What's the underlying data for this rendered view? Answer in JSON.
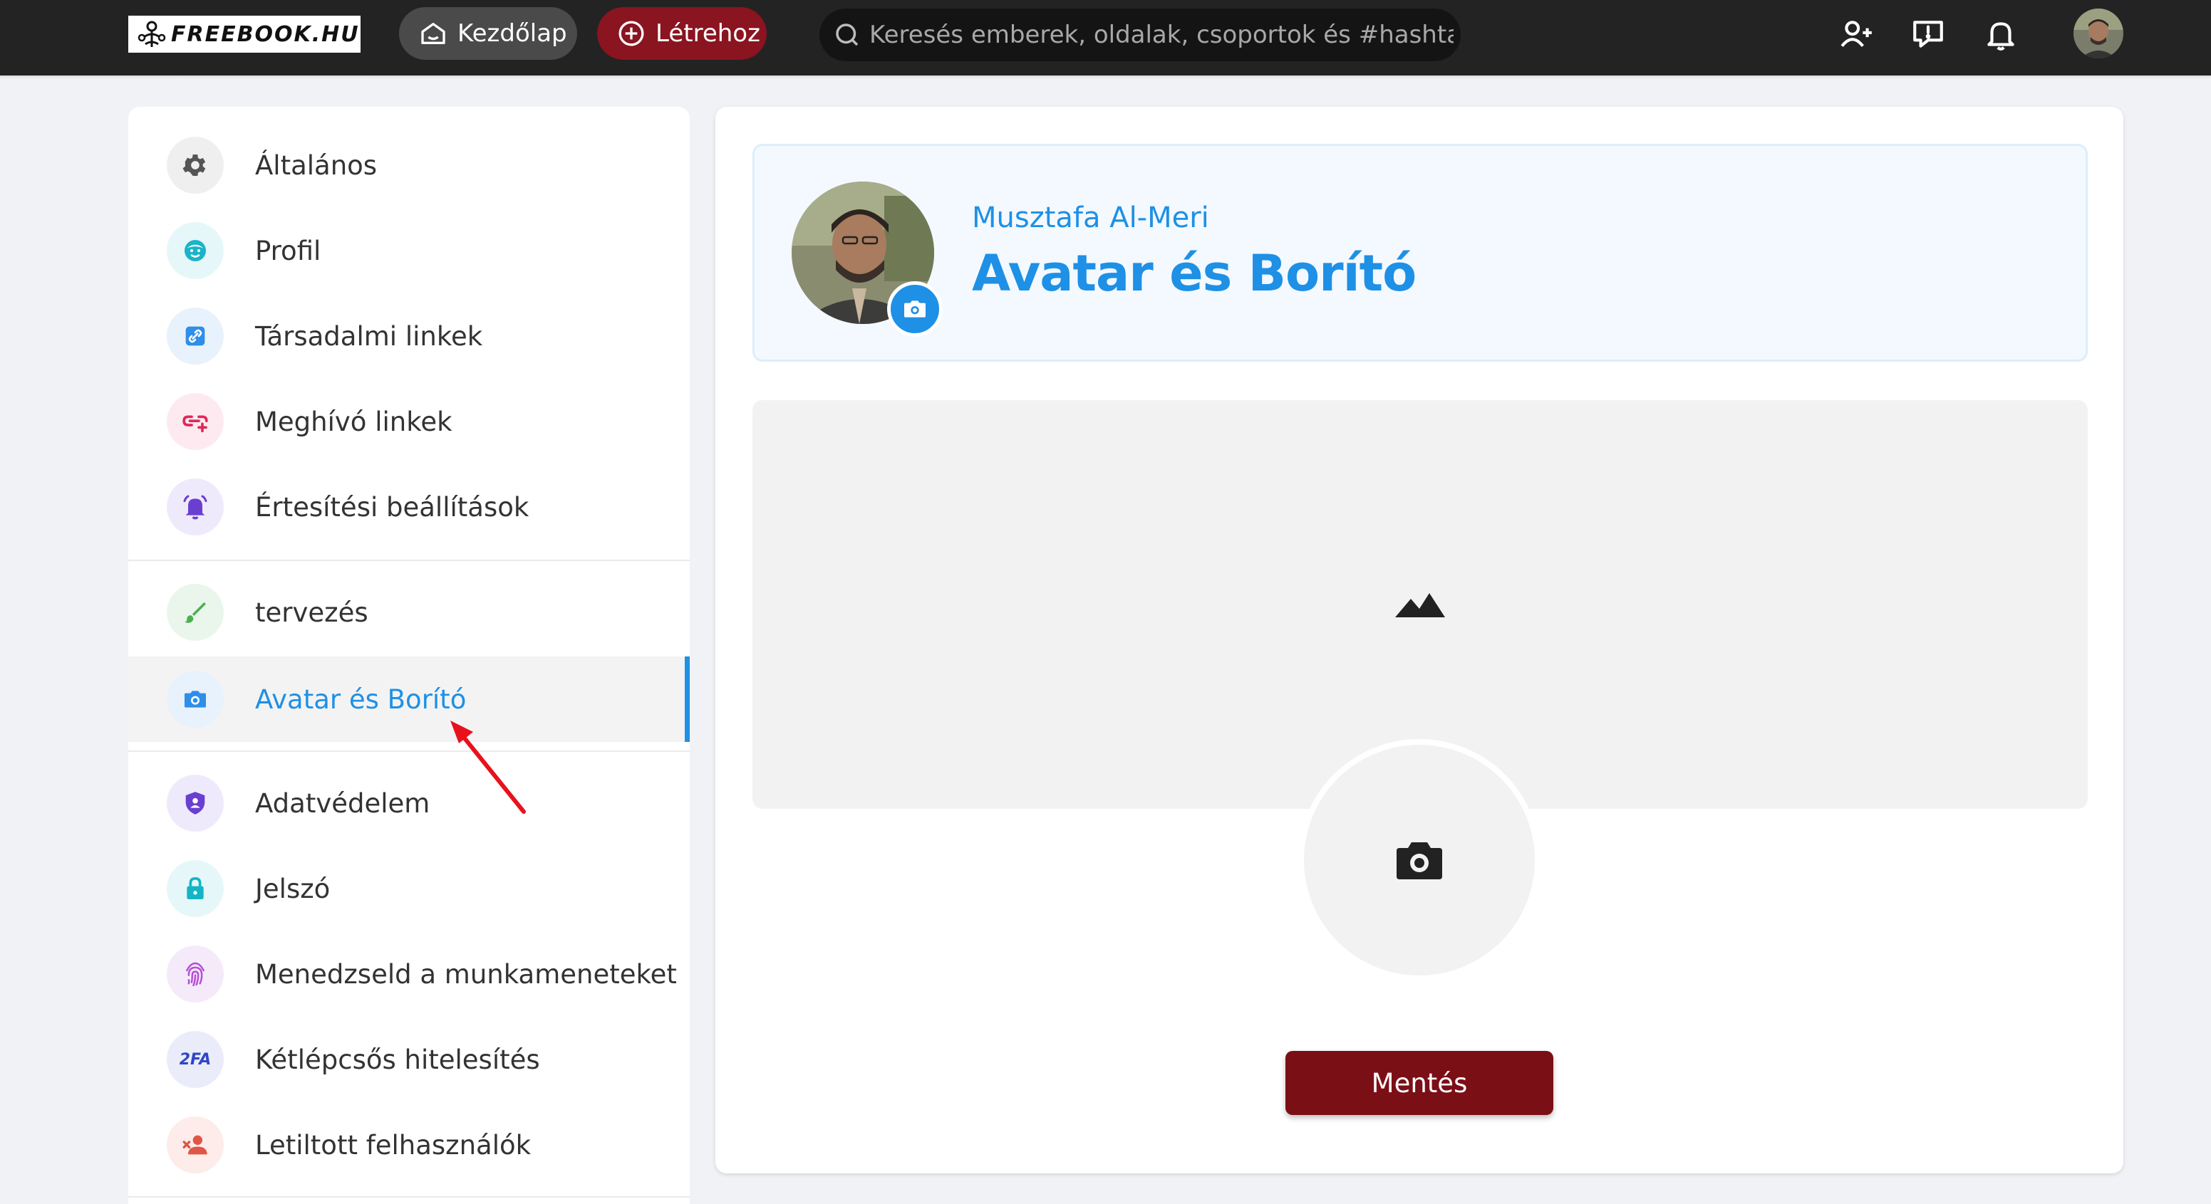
{
  "topbar": {
    "logo_text": "FREEBOOK.HU",
    "home_label": "Kezdőlap",
    "create_label": "Létrehoz",
    "search_placeholder": "Keresés emberek, oldalak, csoportok és #hashtag-ek",
    "icons": [
      "add-friend-icon",
      "messages-icon",
      "notifications-bell-icon",
      "user-avatar"
    ]
  },
  "sidebar": {
    "items": [
      {
        "label": "Általános",
        "icon": "gear-icon",
        "icon_color": "#555555",
        "bg": "#efefef"
      },
      {
        "label": "Profil",
        "icon": "face-icon",
        "icon_color": "#1ab3c8",
        "bg": "#e6f7f9"
      },
      {
        "label": "Társadalmi linkek",
        "icon": "link-icon",
        "icon_color": "#2e8ee8",
        "bg": "#e8f2fc"
      },
      {
        "label": "Meghívó linkek",
        "icon": "invite-link-icon",
        "icon_color": "#e0285a",
        "bg": "#fdeaf0"
      },
      {
        "label": "Értesítési beállítások",
        "icon": "bell-ring-icon",
        "icon_color": "#6a3fd0",
        "bg": "#efeafb"
      },
      {
        "label": "tervezés",
        "icon": "brush-icon",
        "icon_color": "#4caf50",
        "bg": "#eaf6eb"
      },
      {
        "label": "Avatar és Borító",
        "icon": "camera-icon",
        "icon_color": "#2e8ee8",
        "bg": "#e8f2fc",
        "active": true
      },
      {
        "label": "Adatvédelem",
        "icon": "shield-icon",
        "icon_color": "#6a3fd0",
        "bg": "#efeafb"
      },
      {
        "label": "Jelszó",
        "icon": "lock-icon",
        "icon_color": "#13b5c4",
        "bg": "#e6f7f9"
      },
      {
        "label": "Menedzseld a munkameneteket",
        "icon": "fingerprint-icon",
        "icon_color": "#b44fd6",
        "bg": "#f5eafa"
      },
      {
        "label": "Kétlépcsős hitelesítés",
        "icon": "2fa-icon",
        "icon_color": "#3245c6",
        "bg": "#eaecfa",
        "icon_text": "2FA"
      },
      {
        "label": "Letiltott felhasználók",
        "icon": "blocked-user-icon",
        "icon_color": "#e05545",
        "bg": "#fdecea"
      }
    ]
  },
  "main": {
    "user_name": "Musztafa Al-Meri",
    "page_title": "Avatar és Borító",
    "save_label": "Mentés"
  },
  "colors": {
    "accent": "#1e90e6",
    "topbar": "#232323",
    "create_button": "#8a1420",
    "save_button": "#7b0f16"
  }
}
